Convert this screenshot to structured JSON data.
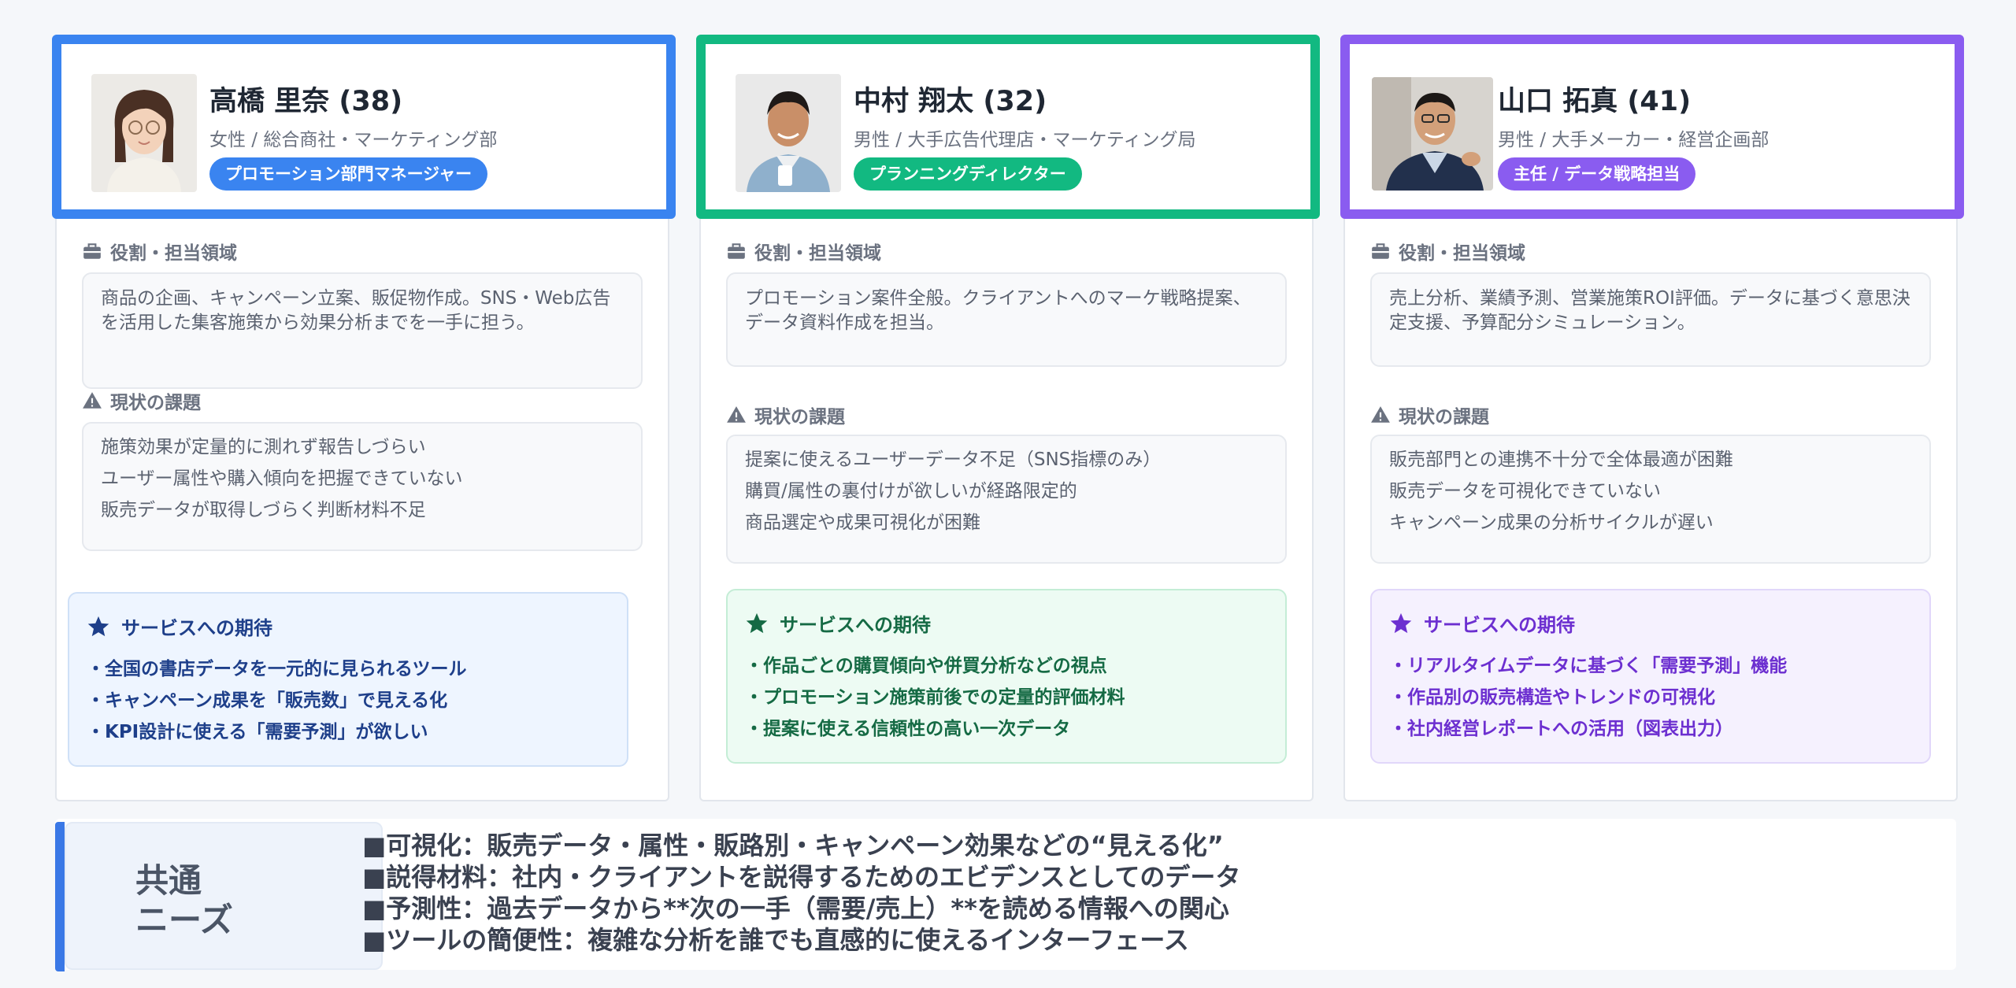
{
  "colors": {
    "blue": "#3a84f0",
    "green": "#12b981",
    "purple": "#8a5cf0"
  },
  "cards": [
    {
      "name": "高橋 里奈 (38)",
      "sub": "女性 / 総合商社・マーケティング部",
      "badge": "プロモーション部門マネージャー",
      "role_label": "役割・担当領域",
      "role_text": "商品の企画、キャンペーン立案、販促物作成。SNS・Web広告を活用した集客施策から効果分析までを一手に担う。",
      "issues_label": "現状の課題",
      "issues": [
        "施策効果が定量的に測れず報告しづらい",
        "ユーザー属性や購入傾向を把握できていない",
        "販売データが取得しづらく判断材料不足"
      ],
      "expect_title": "サービスへの期待",
      "expectations": [
        "・全国の書店データを一元的に見られるツール",
        "・キャンペーン成果を「販売数」で見える化",
        "・KPI設計に使える「需要予測」が欲しい"
      ]
    },
    {
      "name": "中村 翔太 (32)",
      "sub": "男性 / 大手広告代理店・マーケティング局",
      "badge": "プランニングディレクター",
      "role_label": "役割・担当領域",
      "role_text": "プロモーション案件全般。クライアントへのマーケ戦略提案、データ資料作成を担当。",
      "issues_label": "現状の課題",
      "issues": [
        "提案に使えるユーザーデータ不足（SNS指標のみ）",
        "購買/属性の裏付けが欲しいが経路限定的",
        "商品選定や成果可視化が困難"
      ],
      "expect_title": "サービスへの期待",
      "expectations": [
        "・作品ごとの購買傾向や併買分析などの視点",
        "・プロモーション施策前後での定量的評価材料",
        "・提案に使える信頼性の高い一次データ"
      ]
    },
    {
      "name": "山口 拓真 (41)",
      "sub": "男性 / 大手メーカー・経営企画部",
      "badge": "主任 / データ戦略担当",
      "role_label": "役割・担当領域",
      "role_text": "売上分析、業績予測、営業施策ROI評価。データに基づく意思決定支援、予算配分シミュレーション。",
      "issues_label": "現状の課題",
      "issues": [
        "販売部門との連携不十分で全体最適が困難",
        "販売データを可視化できていない",
        "キャンペーン成果の分析サイクルが遅い"
      ],
      "expect_title": "サービスへの期待",
      "expectations": [
        "・リアルタイムデータに基づく「需要予測」機能",
        "・作品別の販売構造やトレンドの可視化",
        "・社内経営レポートへの活用（図表出力）"
      ]
    }
  ],
  "needs": {
    "label_line1": "共通",
    "label_line2": "ニーズ",
    "items": [
      "■可視化：販売データ・属性・販路別・キャンペーン効果などの“見える化”",
      "■説得材料：社内・クライアントを説得するためのエビデンスとしてのデータ",
      "■予測性：過去データから**次の一手（需要/売上）**を読める情報への関心",
      "■ツールの簡便性：複雑な分析を誰でも直感的に使えるインターフェース"
    ]
  },
  "icons": {
    "role": "briefcase-icon",
    "issues": "warning-triangle-icon",
    "expect": "star-icon"
  }
}
